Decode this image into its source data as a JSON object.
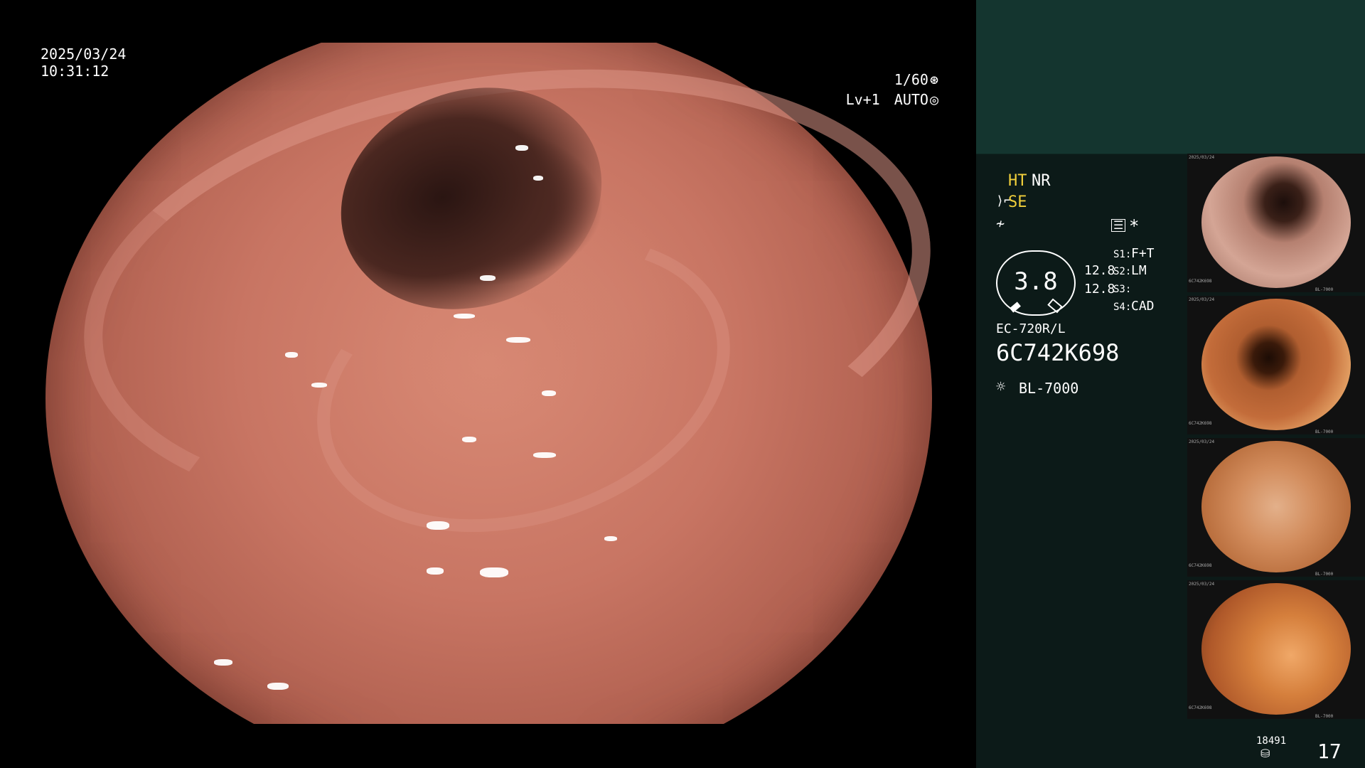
{
  "osd": {
    "date": "2025/03/24",
    "time": "10:31:12",
    "shutter": "1/60",
    "level": "Lv+1",
    "mode": "AUTO"
  },
  "panel": {
    "ht": "HT",
    "nr": "NR",
    "se": "SE",
    "star": "*",
    "gauge_value": "3.8",
    "scale_1": "12.8",
    "scale_2": "12.8",
    "s1_label": "S1:",
    "s1_value": "F+T",
    "s2_label": "S2:",
    "s2_value": "LM",
    "s3_label": "S3:",
    "s3_value": "",
    "s4_label": "S4:",
    "s4_value": "CAD",
    "scope_model": "EC-720R/L",
    "scope_serial": "6C742K698",
    "light_source": "BL-7000",
    "storage_count": "18491",
    "image_count": "17"
  },
  "thumbnails": [
    {
      "date": "2025/03/24",
      "serial": "6C742K698",
      "source": "BL-7000"
    },
    {
      "date": "2025/03/24",
      "serial": "6C742K698",
      "source": "BL-7000"
    },
    {
      "date": "2025/03/24",
      "serial": "6C742K698",
      "source": "BL-7000"
    },
    {
      "date": "2025/03/24",
      "serial": "6C742K698",
      "source": "BL-7000"
    }
  ],
  "colors": {
    "panel_bg": "#0c1a18",
    "panel_top": "#14352f",
    "highlight_yellow": "#f1cf3b"
  }
}
